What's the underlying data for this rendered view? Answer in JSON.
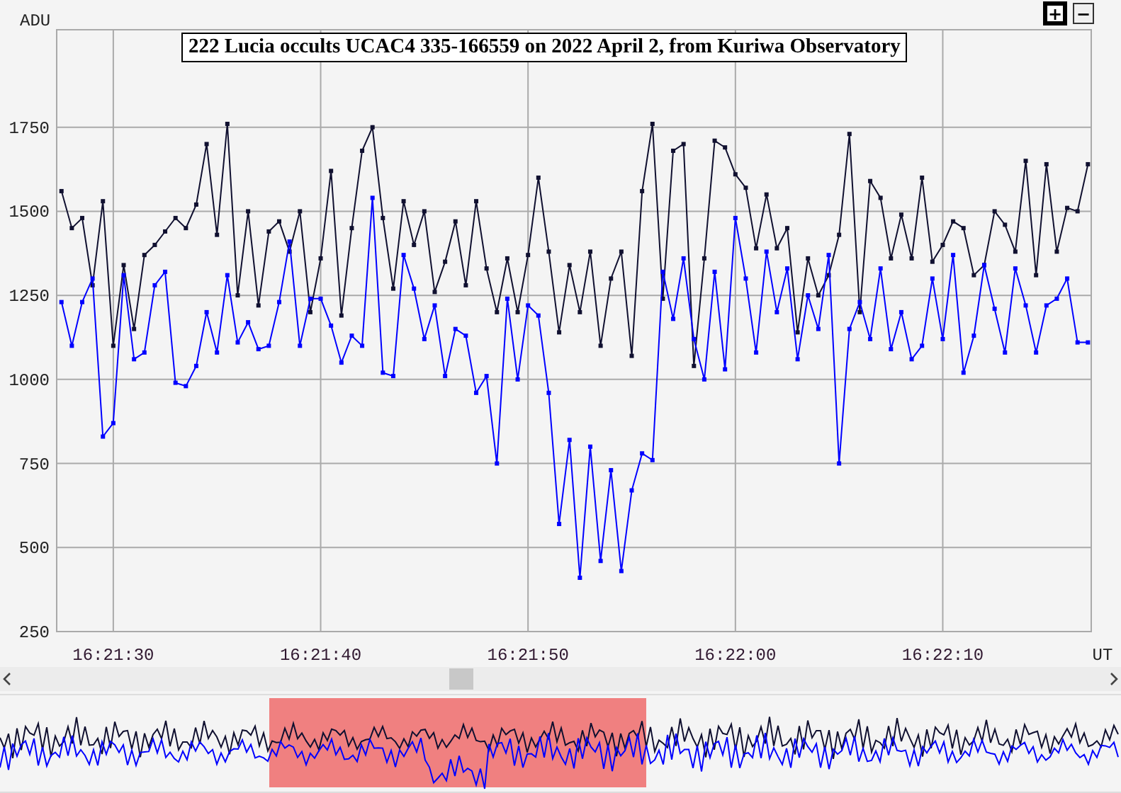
{
  "zoom_buttons": [
    {
      "label": "+",
      "selected": true
    },
    {
      "label": "−",
      "selected": false
    }
  ],
  "chart": {
    "chart_data": {
      "type": "line",
      "grid": true,
      "title": "222 Lucia occults UCAC4 335-166559 on 2022 April 2, from Kuriwa Observatory",
      "xlabel": "UT",
      "ylabel": "ADU",
      "x": [
        58887.5,
        58888,
        58888.5,
        58889,
        58889.5,
        58890,
        58890.5,
        58891,
        58891.5,
        58892,
        58892.5,
        58893,
        58893.5,
        58894,
        58894.5,
        58895,
        58895.5,
        58896,
        58896.5,
        58897,
        58897.5,
        58898,
        58898.5,
        58899,
        58899.5,
        58900,
        58900.5,
        58901,
        58901.5,
        58902,
        58902.5,
        58903,
        58903.5,
        58904,
        58904.5,
        58905,
        58905.5,
        58906,
        58906.5,
        58907,
        58907.5,
        58908,
        58908.5,
        58909,
        58909.5,
        58910,
        58910.5,
        58911,
        58911.5,
        58912,
        58912.5,
        58913,
        58913.5,
        58914,
        58914.5,
        58915,
        58915.5,
        58916,
        58916.5,
        58917,
        58917.5,
        58918,
        58918.5,
        58919,
        58919.5,
        58920,
        58920.5,
        58921,
        58921.5,
        58922,
        58922.5,
        58923,
        58923.5,
        58924,
        58924.5,
        58925,
        58925.5,
        58926,
        58926.5,
        58927,
        58927.5,
        58928,
        58928.5,
        58929,
        58929.5,
        58930,
        58930.5,
        58931,
        58931.5,
        58932,
        58932.5,
        58933,
        58933.5,
        58934,
        58934.5,
        58935,
        58935.5,
        58936,
        58936.5,
        58937
      ],
      "series": [
        {
          "color": "#101030",
          "marker": "square",
          "values": [
            1560,
            1450,
            1480,
            1280,
            1530,
            1100,
            1340,
            1150,
            1370,
            1400,
            1440,
            1480,
            1450,
            1520,
            1700,
            1430,
            1760,
            1250,
            1500,
            1220,
            1440,
            1470,
            1380,
            1500,
            1200,
            1360,
            1620,
            1190,
            1450,
            1680,
            1750,
            1480,
            1270,
            1530,
            1400,
            1500,
            1260,
            1350,
            1470,
            1280,
            1530,
            1330,
            1200,
            1360,
            1200,
            1370,
            1600,
            1380,
            1140,
            1340,
            1200,
            1380,
            1100,
            1300,
            1380,
            1070,
            1560,
            1760,
            1240,
            1680,
            1700,
            1040,
            1360,
            1710,
            1690,
            1610,
            1570,
            1390,
            1550,
            1390,
            1450,
            1140,
            1360,
            1250,
            1310,
            1430,
            1730,
            1200,
            1590,
            1540,
            1360,
            1490,
            1360,
            1600,
            1350,
            1400,
            1470,
            1450,
            1310,
            1340,
            1500,
            1460,
            1380,
            1650,
            1310,
            1640,
            1380,
            1510,
            1500,
            1640
          ]
        },
        {
          "color": "#0000ff",
          "marker": "square",
          "values": [
            1230,
            1100,
            1230,
            1300,
            830,
            870,
            1310,
            1060,
            1080,
            1280,
            1320,
            990,
            980,
            1040,
            1200,
            1080,
            1310,
            1110,
            1170,
            1090,
            1100,
            1230,
            1410,
            1100,
            1240,
            1240,
            1160,
            1050,
            1130,
            1100,
            1540,
            1020,
            1010,
            1370,
            1270,
            1120,
            1220,
            1010,
            1150,
            1130,
            960,
            1010,
            750,
            1240,
            1000,
            1220,
            1190,
            960,
            570,
            820,
            410,
            800,
            460,
            730,
            430,
            670,
            780,
            760,
            1320,
            1180,
            1360,
            1120,
            1000,
            1320,
            1030,
            1480,
            1300,
            1080,
            1380,
            1200,
            1330,
            1060,
            1250,
            1150,
            1370,
            750,
            1150,
            1230,
            1120,
            1330,
            1090,
            1200,
            1060,
            1100,
            1300,
            1120,
            1370,
            1020,
            1130,
            1340,
            1210,
            1080,
            1330,
            1220,
            1080,
            1220,
            1240,
            1300,
            1110,
            1110
          ]
        }
      ],
      "xlim": [
        58887.27,
        58937.16
      ],
      "ylim": [
        250,
        2040
      ],
      "xticks": [
        {
          "value": 58890,
          "label": "16:21:30"
        },
        {
          "value": 58900,
          "label": "16:21:40"
        },
        {
          "value": 58910,
          "label": "16:21:50"
        },
        {
          "value": 58920,
          "label": "16:22:00"
        },
        {
          "value": 58930,
          "label": "16:22:10"
        }
      ],
      "yticks": [
        250,
        500,
        750,
        1000,
        1250,
        1500,
        1750
      ]
    }
  }
}
